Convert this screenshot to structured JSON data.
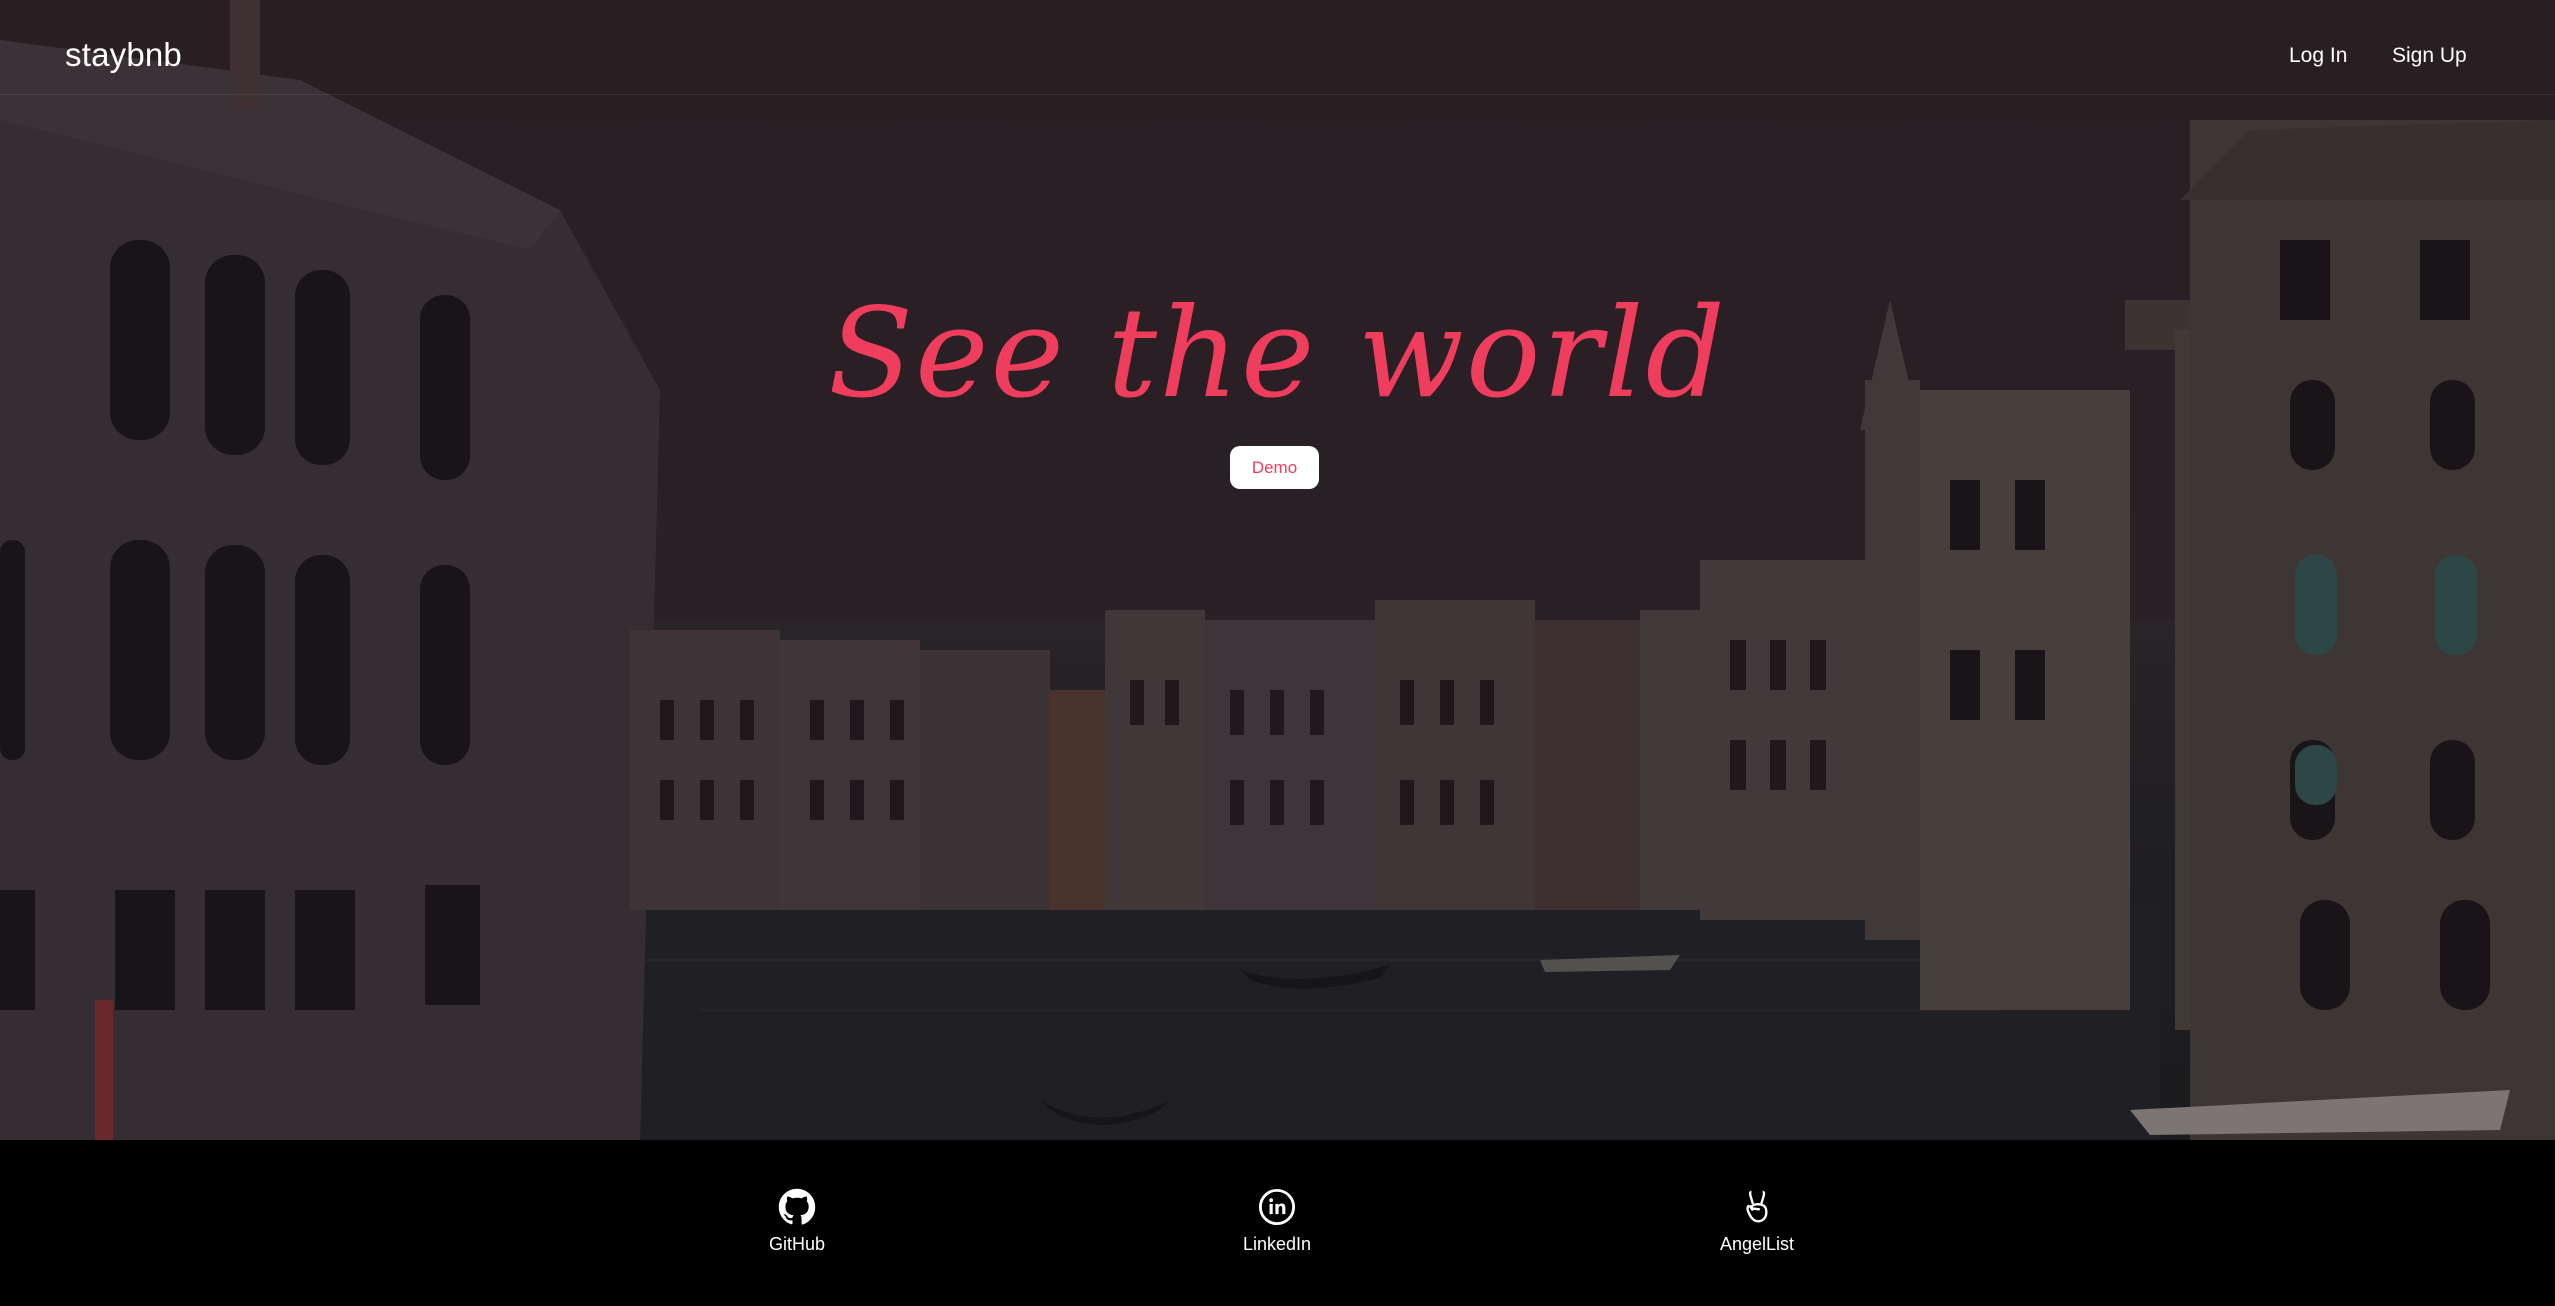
{
  "header": {
    "logo": "staybnb",
    "login_label": "Log In",
    "signup_label": "Sign Up"
  },
  "hero": {
    "headline": "See the world",
    "demo_label": "Demo",
    "background_image": "venice-grand-canal-photo"
  },
  "footer": {
    "links": [
      {
        "label": "GitHub",
        "icon": "github-icon"
      },
      {
        "label": "LinkedIn",
        "icon": "linkedin-icon"
      },
      {
        "label": "AngelList",
        "icon": "angellist-icon"
      }
    ]
  },
  "colors": {
    "accent": "#ef3e5d",
    "text": "#ffffff",
    "footer_bg": "#000000"
  }
}
